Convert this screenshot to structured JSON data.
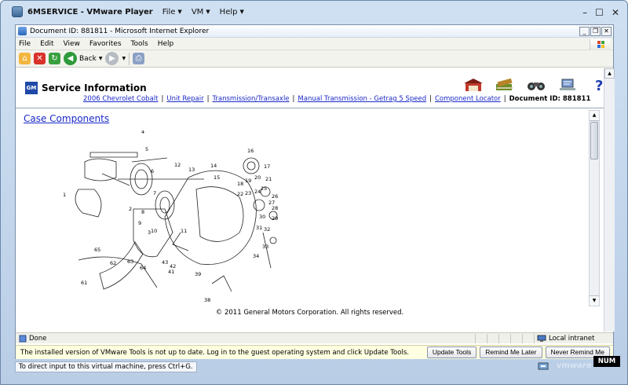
{
  "vm": {
    "title": "6MSERVICE - VMware Player",
    "menus": [
      {
        "label": "File"
      },
      {
        "label": "VM"
      },
      {
        "label": "Help"
      }
    ],
    "status_hint": "To direct input to this virtual machine, press Ctrl+G.",
    "brand": "vmware",
    "num_indicator": "NUM"
  },
  "browser": {
    "title": "Document ID: 881811 - Microsoft Internet Explorer",
    "menu": [
      "File",
      "Edit",
      "View",
      "Favorites",
      "Tools",
      "Help"
    ],
    "back_label": "Back",
    "status_text": "Done",
    "zone": "Local intranet"
  },
  "page": {
    "header_title": "Service Information",
    "logo_text": "GM",
    "breadcrumbs": [
      {
        "label": "2006 Chevrolet Cobalt"
      },
      {
        "label": "Unit Repair"
      },
      {
        "label": "Transmission/Transaxle"
      },
      {
        "label": "Manual Transmission - Getrag 5 Speed"
      },
      {
        "label": "Component Locator"
      }
    ],
    "document_id": "Document ID: 881811",
    "section_title": "Case Components",
    "copyright": "© 2011 General Motors Corporation.  All rights reserved.",
    "diagram_callouts": [
      "1",
      "2",
      "3",
      "4",
      "5",
      "6",
      "7",
      "8",
      "9",
      "10",
      "11",
      "12",
      "13",
      "14",
      "15",
      "16",
      "17",
      "18",
      "19",
      "20",
      "21",
      "22",
      "23",
      "24",
      "25",
      "26",
      "27",
      "28",
      "29",
      "30",
      "31",
      "32",
      "33",
      "34",
      "38",
      "39",
      "41",
      "42",
      "43",
      "61",
      "62",
      "63",
      "64",
      "65"
    ]
  },
  "vmtools": {
    "message": "The installed version of VMware Tools is not up to date. Log in to the guest operating system and click Update Tools.",
    "update_label": "Update Tools",
    "remind_label": "Remind Me Later",
    "never_label": "Never Remind Me"
  },
  "colors": {
    "link": "#1a29c8",
    "gm_blue": "#1f49a8",
    "vm_frame": "#b9cde6",
    "info_bar": "#ffffe1"
  }
}
